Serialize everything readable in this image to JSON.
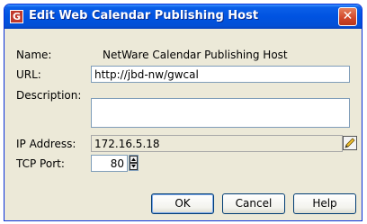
{
  "window": {
    "title": "Edit Web Calendar Publishing Host",
    "icon": "app-icon-g",
    "close_symbol": "✕"
  },
  "form": {
    "name_label": "Name:",
    "name_value": "NetWare Calendar Publishing Host",
    "url_label": "URL:",
    "url_value": "http://jbd-nw/gwcal",
    "description_label": "Description:",
    "description_value": "",
    "ip_label": "IP Address:",
    "ip_value": "172.16.5.18",
    "port_label": "TCP Port:",
    "port_value": "80"
  },
  "buttons": {
    "ok": "OK",
    "cancel": "Cancel",
    "help": "Help"
  },
  "icons": {
    "edit_ip": "pencil-icon",
    "spinner": "spin-up-down-icon"
  }
}
